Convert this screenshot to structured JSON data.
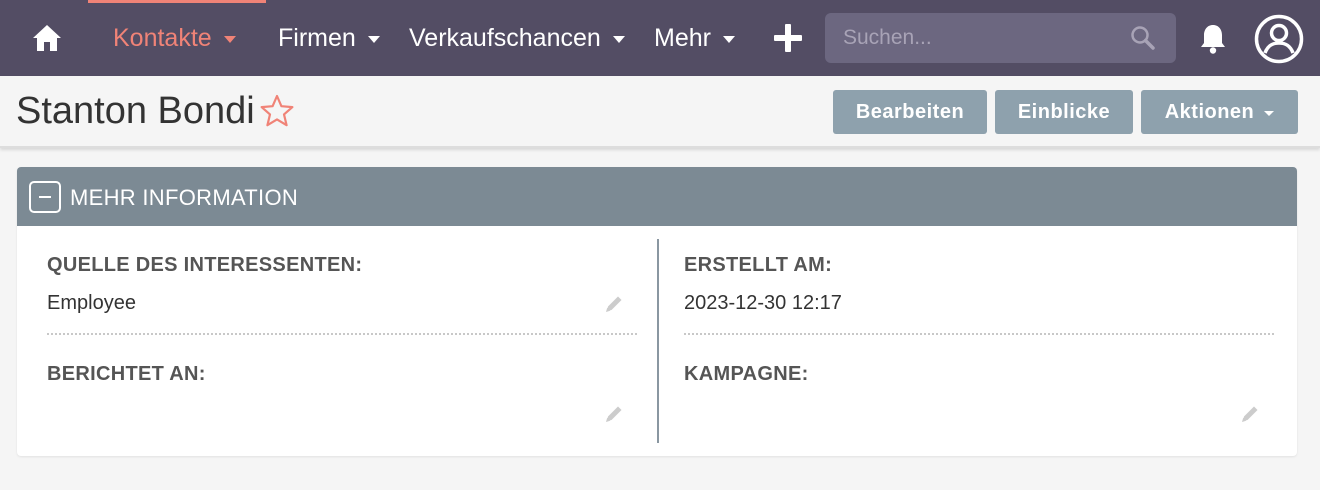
{
  "nav": {
    "items": [
      {
        "label": "Kontakte"
      },
      {
        "label": "Firmen"
      },
      {
        "label": "Verkaufschancen"
      },
      {
        "label": "Mehr"
      }
    ],
    "search_placeholder": "Suchen...",
    "active_color": "#f08377",
    "bg_color": "#534d64"
  },
  "header": {
    "title": "Stanton Bondi",
    "buttons": {
      "edit": "Bearbeiten",
      "insights": "Einblicke",
      "actions": "Aktionen"
    }
  },
  "panel": {
    "title": "MEHR INFORMATION",
    "fields": [
      {
        "label": "QUELLE DES INTERESSENTEN:",
        "value": "Employee"
      },
      {
        "label": "ERSTELLT AM:",
        "value": "2023-12-30 12:17"
      },
      {
        "label": "BERICHTET AN:",
        "value": ""
      },
      {
        "label": "KAMPAGNE:",
        "value": ""
      }
    ]
  }
}
